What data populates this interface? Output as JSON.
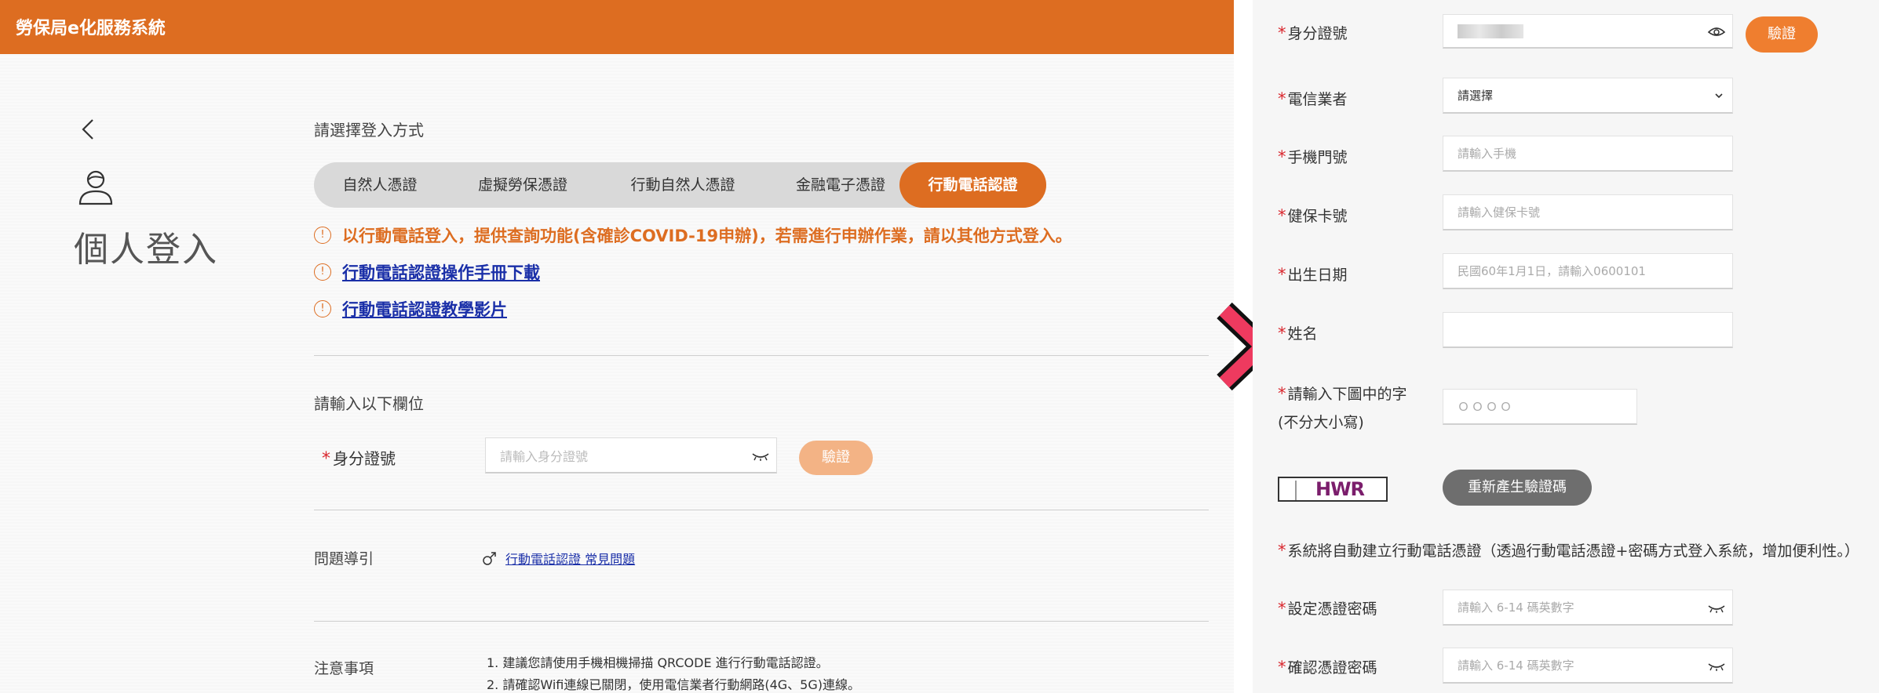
{
  "app": {
    "title": "勞保局e化服務系統"
  },
  "page": {
    "title": "個人登入"
  },
  "login": {
    "choose_label": "請選擇登入方式",
    "tabs": [
      "自然人憑證",
      "虛擬勞保憑證",
      "行動自然人憑證",
      "金融電子憑證",
      "行動電話認證"
    ],
    "active_tab": "行動電話認證",
    "notices": {
      "warning": "以行動電話登入，提供查詢功能(含確診COVID-19申辦)，若需進行申辦作業，請以其他方式登入。",
      "manual_link": "行動電話認證操作手冊下載",
      "video_link": "行動電話認證教學影片"
    },
    "notice_icon": "!"
  },
  "fields": {
    "section_label": "請輸入以下欄位",
    "required_mark": "*",
    "id_label": "身分證號",
    "id_placeholder": "請輸入身分證號",
    "verify_button": "驗證"
  },
  "faq": {
    "label": "問題導引",
    "link": "行動電話認證 常見問題"
  },
  "notes": {
    "label": "注意事項",
    "items": [
      "1. 建議您請使用手機相機掃描 QRCODE 進行行動電話認證。",
      "2. 請確認Wifi連線已關閉，使用電信業者行動網路(4G、5G)連線。"
    ]
  },
  "right_form": {
    "id_label": "身分證號",
    "verify_button": "驗證",
    "carrier_label": "電信業者",
    "carrier_selected": "請選擇",
    "phone_label": "手機門號",
    "phone_placeholder": "請輸入手機",
    "nhi_label": "健保卡號",
    "nhi_placeholder": "請輸入健保卡號",
    "birth_label": "出生日期",
    "birth_placeholder": "民國60年1月1日，請輸入0600101",
    "name_label": "姓名",
    "captcha_label_1": "請輸入下圖中的字",
    "captcha_label_2": "(不分大小寫)",
    "captcha_placeholder": "ＯＯＯＯ",
    "captcha_text": "HWR",
    "regen_button": "重新產生驗證碼",
    "auto_create_note": "系統將自動建立行動電話憑證（透過行動電話憑證+密碼方式登入系統，增加便利性。）",
    "set_pw_label": "設定憑證密碼",
    "set_pw_placeholder": "請輸入 6-14 碼英數字",
    "confirm_pw_label": "確認憑證密碼",
    "confirm_pw_placeholder": "請輸入 6-14 碼英數字"
  },
  "colors": {
    "brand": "#dd6d21",
    "required": "#d9272e",
    "link": "#1a2fa8",
    "arrow": "#ee3a5f"
  }
}
